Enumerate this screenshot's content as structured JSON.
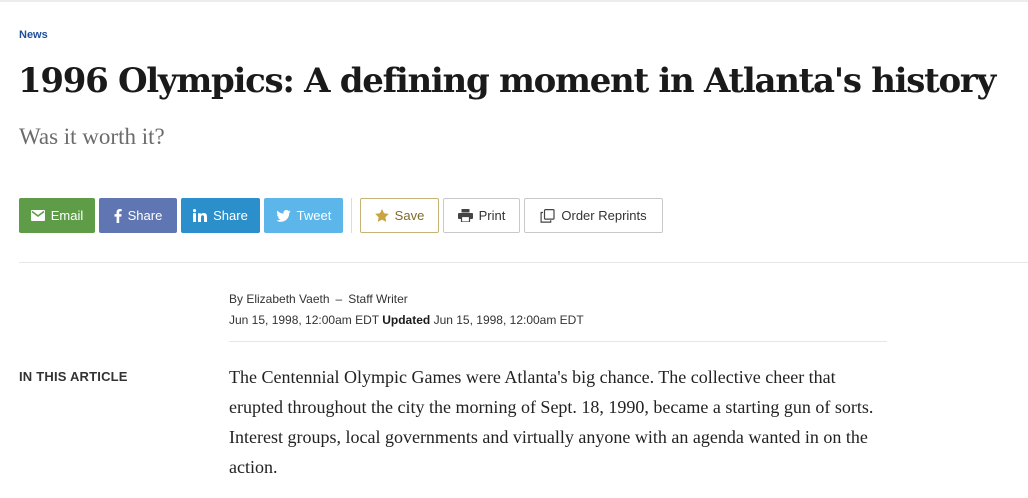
{
  "section": {
    "label": "News"
  },
  "article": {
    "headline": "1996 Olympics: A defining moment in Atlanta's history",
    "dek": "Was it worth it?"
  },
  "share": {
    "email": "Email",
    "facebook": "Share",
    "linkedin": "Share",
    "twitter": "Tweet",
    "save": "Save",
    "print": "Print",
    "reprints": "Order Reprints"
  },
  "byline": {
    "author": "By Elizabeth Vaeth",
    "separator": "–",
    "role": "Staff Writer",
    "published": "Jun 15, 1998, 12:00am EDT",
    "updated_label": "Updated",
    "updated": "Jun 15, 1998, 12:00am EDT"
  },
  "sidebar": {
    "in_this_article": "IN THIS ARTICLE"
  },
  "body": {
    "paragraph1": "The Centennial Olympic Games were Atlanta's big chance. The collective cheer that erupted throughout the city the morning of Sept. 18, 1990, became a starting gun of sorts. Interest groups, local governments and virtually anyone with an agenda wanted in on the action."
  },
  "colors": {
    "section_link": "#1f4e9a",
    "email": "#5e9c47",
    "facebook": "#5f76b3",
    "linkedin": "#2a8fca",
    "twitter": "#5cb6e9",
    "save_star": "#c9a441"
  },
  "icons": {
    "email": "envelope-icon",
    "facebook": "facebook-icon",
    "linkedin": "linkedin-icon",
    "twitter": "twitter-bird-icon",
    "save": "star-icon",
    "print": "printer-icon",
    "reprints": "copy-document-icon"
  }
}
